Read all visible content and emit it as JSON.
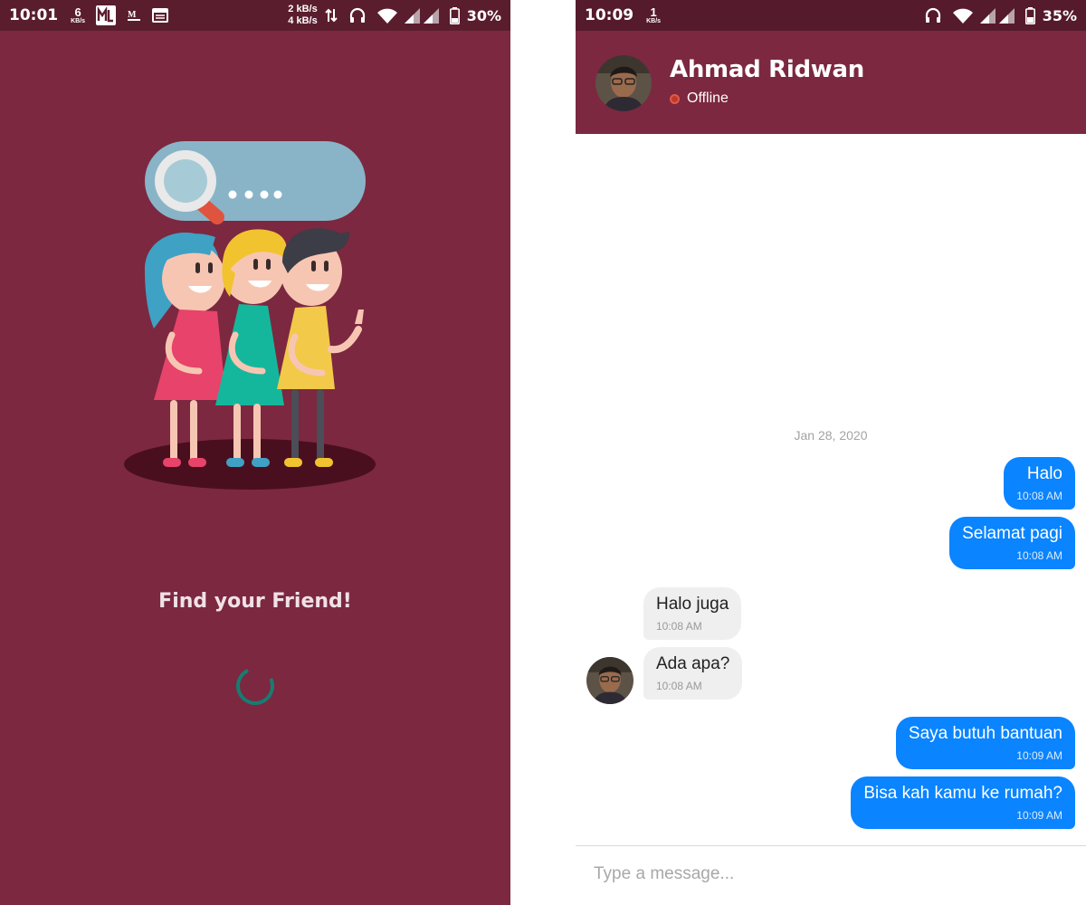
{
  "splash": {
    "status_bar": {
      "time": "10:01",
      "net_speed_value": "6",
      "net_speed_unit": "KB/s",
      "upload_rate": "2 kB/s",
      "download_rate": "4 kB/s",
      "battery_percent": "30%"
    },
    "title": "Find your Friend!"
  },
  "chat": {
    "status_bar": {
      "time": "10:09",
      "net_speed_value": "1",
      "net_speed_unit": "KB/s",
      "battery_percent": "35%"
    },
    "header": {
      "contact_name": "Ahmad Ridwan",
      "presence": "Offline"
    },
    "date_separator": "Jan 28, 2020",
    "messages": [
      {
        "direction": "outgoing",
        "text": "Halo",
        "time": "10:08 AM"
      },
      {
        "direction": "outgoing",
        "text": "Selamat pagi",
        "time": "10:08 AM"
      },
      {
        "direction": "incoming",
        "text": "Halo juga",
        "time": "10:08 AM"
      },
      {
        "direction": "incoming",
        "text": "Ada apa?",
        "time": "10:08 AM"
      },
      {
        "direction": "outgoing",
        "text": "Saya butuh bantuan",
        "time": "10:09 AM"
      },
      {
        "direction": "outgoing",
        "text": "Bisa kah kamu ke rumah?",
        "time": "10:09 AM"
      }
    ],
    "composer": {
      "placeholder": "Type a message..."
    }
  },
  "colors": {
    "brand": "#7c2840",
    "status_bar": "#551a2c",
    "outgoing_bubble": "#0a84ff",
    "incoming_bubble": "#efefef",
    "spinner": "#177d72",
    "presence_offline": "#c0392b"
  }
}
